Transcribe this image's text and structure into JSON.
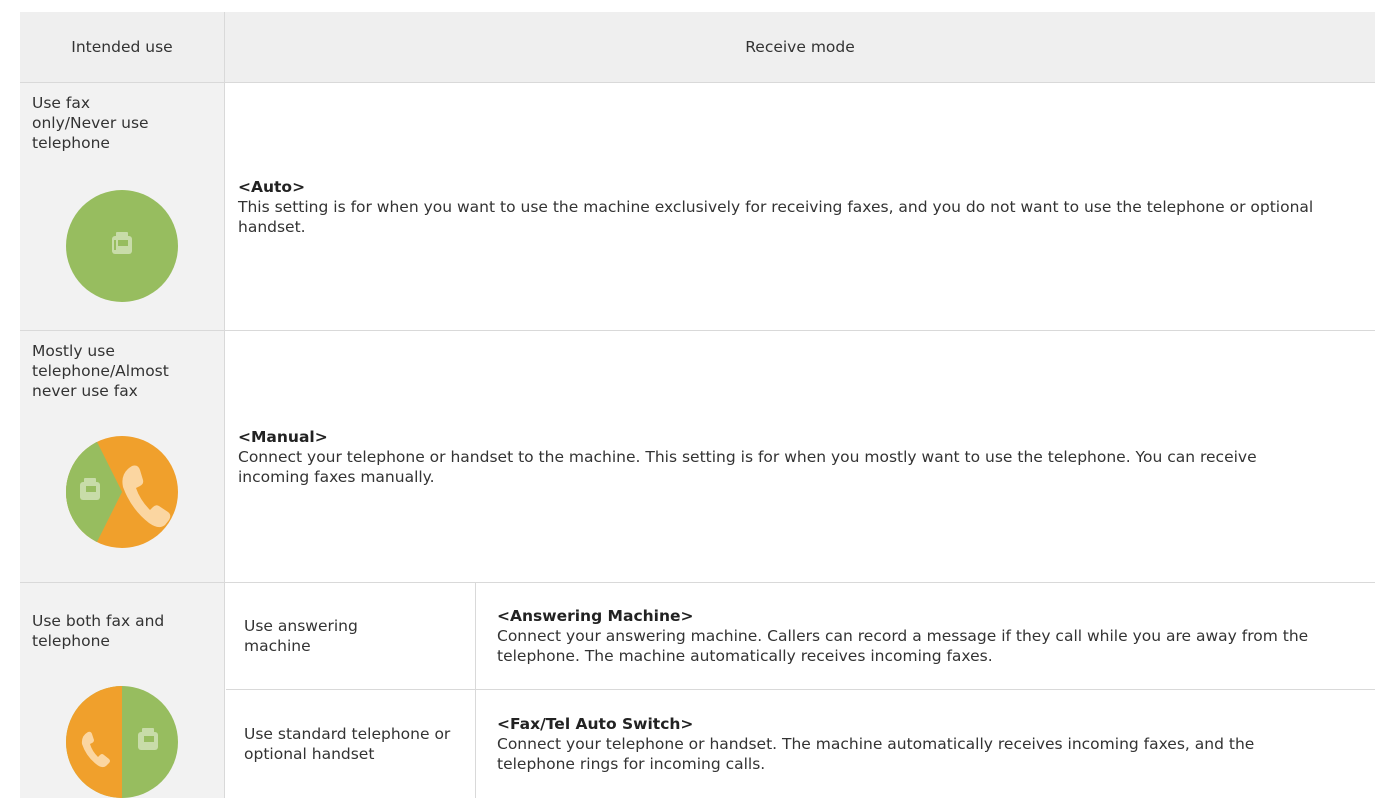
{
  "header": {
    "intended_use": "Intended use",
    "receive_mode": "Receive mode"
  },
  "rows": [
    {
      "use": "Use fax only/Never use telephone",
      "mode_title": "<Auto>",
      "mode_desc": "This setting is for when you want to use the machine exclusively for receiving faxes, and you do not want to use the telephone or optional handset.",
      "icon": "fax-icon"
    },
    {
      "use": "Mostly use telephone/Almost never use fax",
      "mode_title": "<Manual>",
      "mode_desc": "Connect your telephone or handset to the machine. This setting is for when you mostly want to use the telephone. You can receive incoming faxes manually.",
      "icon": "telephone-fax-icon"
    },
    {
      "use": "Use both fax and telephone",
      "icon": "fax-telephone-split-icon",
      "sub": [
        {
          "label": "Use answering machine",
          "mode_title": "<Answering Machine>",
          "mode_desc": "Connect your answering machine. Callers can record a message if they call while you are away from the telephone. The machine automatically receives incoming faxes."
        },
        {
          "label": "Use standard telephone or optional handset",
          "mode_title": "<Fax/Tel Auto Switch>",
          "mode_desc": "Connect your telephone or handset. The machine automatically receives incoming faxes, and the telephone rings for incoming calls."
        }
      ]
    }
  ],
  "colors": {
    "green": "#97bd5f",
    "orange": "#f0a02c",
    "header_bg": "#efefef",
    "left_bg": "#f2f2f2",
    "border": "#d9d9d9"
  }
}
